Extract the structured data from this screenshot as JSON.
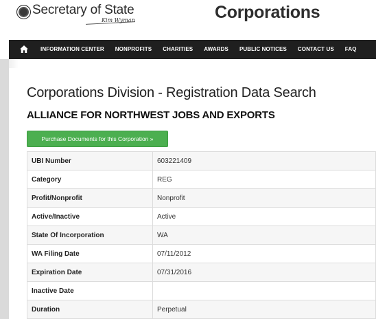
{
  "header": {
    "logo_text": "Secretary of State",
    "signature": "Kim Wyman",
    "section_title": "Corporations"
  },
  "nav": {
    "items": [
      {
        "label": "INFORMATION CENTER"
      },
      {
        "label": "NONPROFITS"
      },
      {
        "label": "CHARITIES"
      },
      {
        "label": "AWARDS"
      },
      {
        "label": "PUBLIC NOTICES"
      },
      {
        "label": "CONTACT US"
      },
      {
        "label": "FAQ"
      }
    ]
  },
  "main": {
    "page_title": "Corporations Division - Registration Data Search",
    "corporation_name": "ALLIANCE FOR NORTHWEST JOBS AND EXPORTS",
    "purchase_button": "Purchase Documents for this Corporation »",
    "rows": [
      {
        "label": "UBI Number",
        "value": "603221409"
      },
      {
        "label": "Category",
        "value": "REG"
      },
      {
        "label": "Profit/Nonprofit",
        "value": "Nonprofit"
      },
      {
        "label": "Active/Inactive",
        "value": "Active"
      },
      {
        "label": "State Of Incorporation",
        "value": "WA"
      },
      {
        "label": "WA Filing Date",
        "value": "07/11/2012"
      },
      {
        "label": "Expiration Date",
        "value": "07/31/2016"
      },
      {
        "label": "Inactive Date",
        "value": ""
      },
      {
        "label": "Duration",
        "value": "Perpetual"
      }
    ]
  },
  "colors": {
    "nav_bg": "#1f1f1f",
    "button_green": "#4caf50"
  }
}
